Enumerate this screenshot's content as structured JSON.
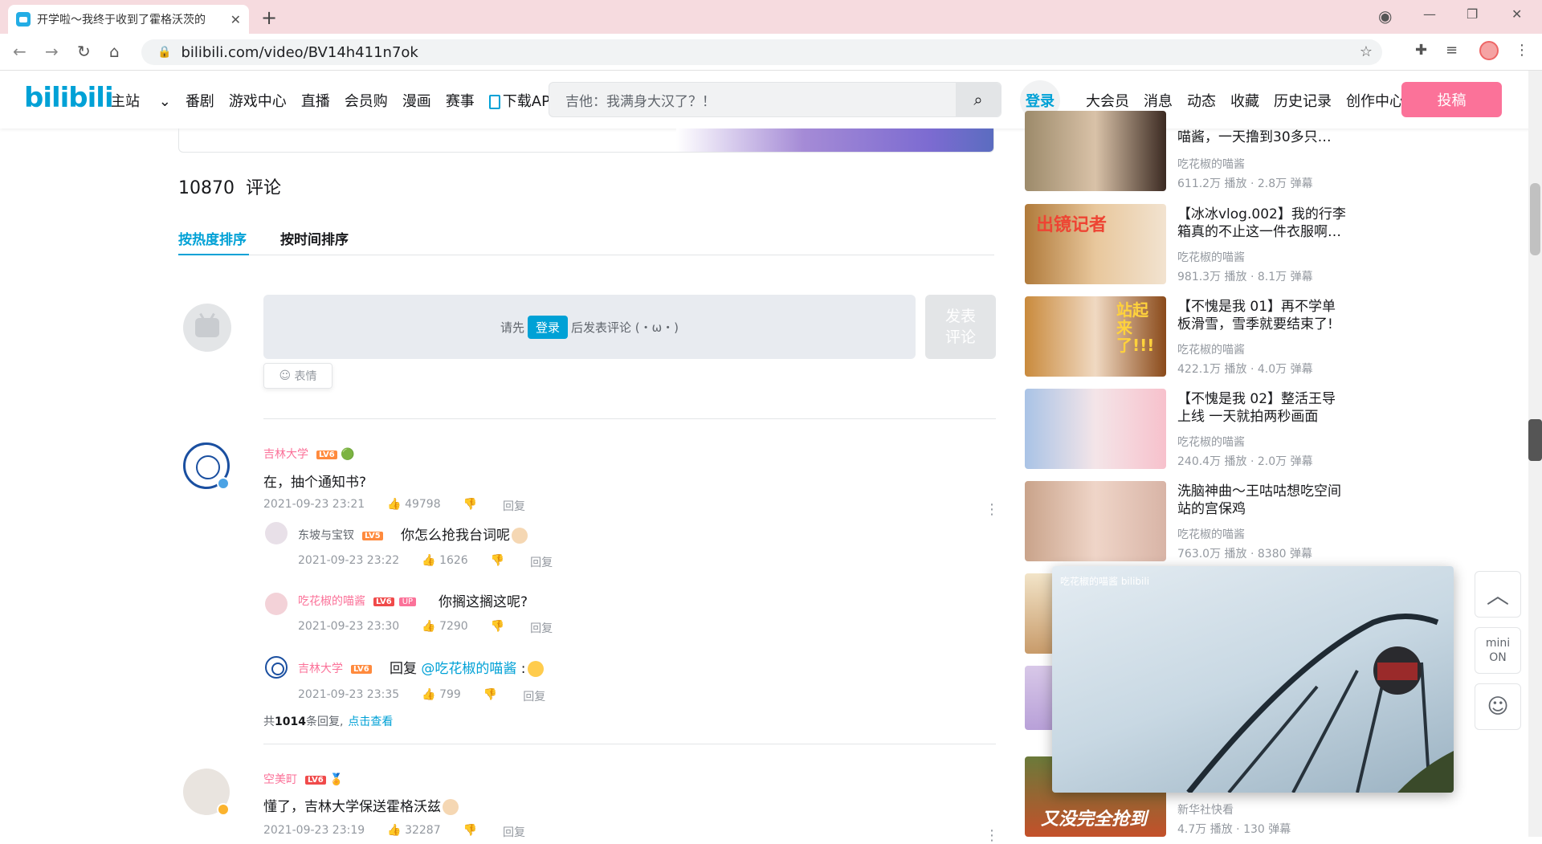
{
  "browser": {
    "tab_title": "开学啦～我终于收到了霍格沃茨的",
    "tab_close": "✕",
    "new_tab": "+",
    "url": "bilibili.com/video/BV14h411n7ok",
    "win_min": "—",
    "win_max": "❐",
    "win_close": "✕"
  },
  "header": {
    "logo": "bilibili",
    "nav": [
      "主站",
      "番剧",
      "游戏中心",
      "直播",
      "会员购",
      "漫画",
      "赛事",
      "下载APP"
    ],
    "search_placeholder": "吉他：我满身大汉了？！",
    "login": "登录",
    "right_nav": [
      "大会员",
      "消息",
      "动态",
      "收藏",
      "历史记录",
      "创作中心"
    ],
    "upload": "投稿"
  },
  "comments_section": {
    "count": "10870",
    "count_label": "评论",
    "sort_hot": "按热度排序",
    "sort_time": "按时间排序",
    "login_prompt_prefix": "请先",
    "login_prompt_button": "登录",
    "login_prompt_suffix": "后发表评论 (・ω・)",
    "post_button": "发表\n评论",
    "emoji_button": "表情"
  },
  "comments": [
    {
      "user": "吉林大学",
      "level": "LV6",
      "text": "在，抽个通知书?",
      "time": "2021-09-23 23:21",
      "likes": "49798",
      "reply_label": "回复",
      "replies": [
        {
          "user": "东坡与宝钗",
          "level": "LV5",
          "text": "你怎么抢我台词呢",
          "time": "2021-09-23 23:22",
          "likes": "1626",
          "reply_label": "回复"
        },
        {
          "user": "吃花椒的喵酱",
          "level": "LV6",
          "up": "UP",
          "text": "你搁这搁这呢?",
          "time": "2021-09-23 23:30",
          "likes": "7290",
          "reply_label": "回复"
        },
        {
          "user": "吉林大学",
          "level": "LV6",
          "text_prefix": "回复",
          "mention": "@吃花椒的喵酱",
          "text_suffix": " :",
          "time": "2021-09-23 23:35",
          "likes": "799",
          "reply_label": "回复"
        }
      ],
      "reply_total_prefix": "共",
      "reply_total_count": "1014",
      "reply_total_suffix": "条回复,",
      "reply_view": "点击查看"
    },
    {
      "user": "空美町",
      "level": "LV6",
      "text": "懂了，吉林大学保送霍格沃兹",
      "time": "2021-09-23 23:19",
      "likes": "32287",
      "reply_label": "回复"
    }
  ],
  "related_videos": [
    {
      "title": "喵酱，一天撸到30多只…",
      "author": "吃花椒的喵酱",
      "stats": "611.2万 播放 · 2.8万 弹幕"
    },
    {
      "title": "【冰冰vlog.002】我的行李箱真的不止这一件衣服啊…",
      "author": "吃花椒的喵酱",
      "stats": "981.3万 播放 · 8.1万 弹幕"
    },
    {
      "title": "【不愧是我 01】再不学单板滑雪，雪季就要结束了!",
      "author": "吃花椒的喵酱",
      "stats": "422.1万 播放 · 4.0万 弹幕"
    },
    {
      "title": "【不愧是我 02】整活王导上线 一天就拍两秒画面",
      "author": "吃花椒的喵酱",
      "stats": "240.4万 播放 · 2.0万 弹幕"
    },
    {
      "title": "洗脑神曲～王咕咕想吃空间站的宫保鸡",
      "author": "吃花椒的喵酱",
      "stats": "763.0万 播放 · 8380 弹幕"
    },
    {
      "title": "",
      "author": "新华社快看",
      "stats": "4.7万 播放 · 130 弹幕"
    }
  ],
  "thumb_texts": {
    "v2": "出镜记者",
    "v3": "站起来了!!!",
    "v6": "又没完全抢到"
  },
  "mini_player": {
    "label": "吃花椒的喵酱 bilibili"
  },
  "float_buttons": {
    "top": "︿",
    "mini_line1": "mini",
    "mini_line2": "ON",
    "service": "☺"
  }
}
